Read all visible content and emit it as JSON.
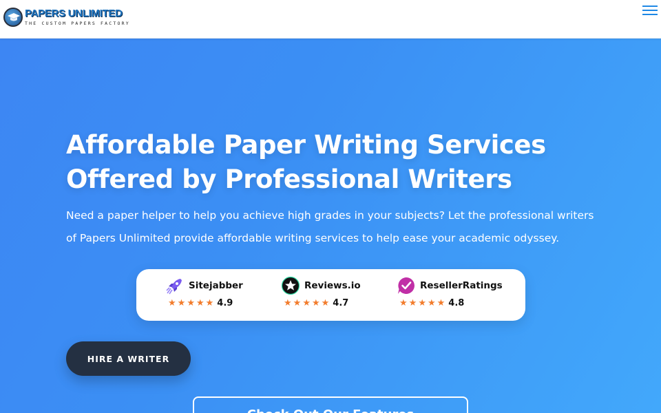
{
  "brand": {
    "name": "PAPERS UNLIMITED",
    "tagline": "THE CUSTOM PAPERS FACTORY",
    "color": "#1e73be"
  },
  "header": {
    "menu_icon": "hamburger-menu-icon"
  },
  "hero": {
    "headline_line1": "Affordable Paper Writing Services",
    "headline_line2": "Offered by Professional Writers",
    "subtext": "Need a paper helper to help you achieve high grades in your subjects? Let the professional writers of Papers Unlimited provide affordable writing services to help ease your academic odyssey.",
    "background_start": "#3d86f3",
    "background_end": "#42a8fb"
  },
  "ratings": [
    {
      "name": "Sitejabber",
      "score": "4.9",
      "icon": "rocket-icon"
    },
    {
      "name": "Reviews.io",
      "score": "4.7",
      "icon": "star-badge-icon"
    },
    {
      "name": "ResellerRatings",
      "score": "4.8",
      "icon": "checkmark-bubble-icon"
    }
  ],
  "star_color": "#f27c2c",
  "cta": {
    "hire_label": "HIRE A WRITER",
    "secondary_label": "Check Out Our Features"
  }
}
